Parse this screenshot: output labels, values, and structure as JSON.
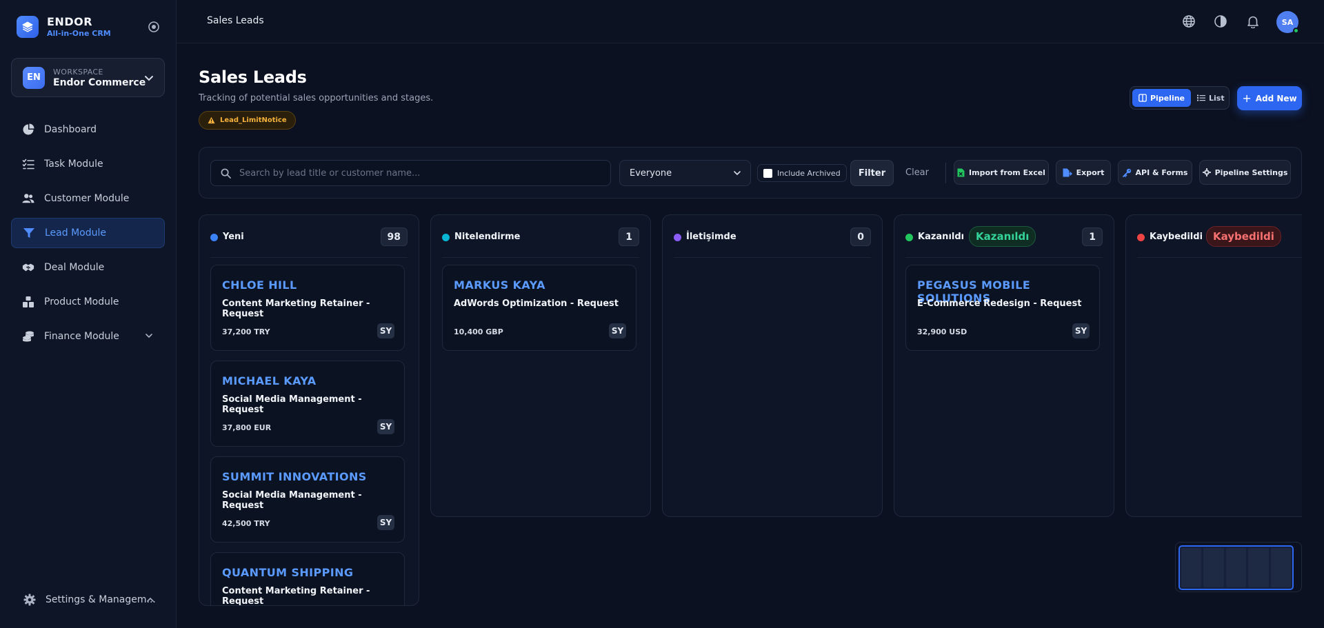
{
  "app": {
    "name": "ENDOR",
    "tagline": "All-in-One CRM"
  },
  "workspace": {
    "label": "WORKSPACE",
    "name": "Endor Commerce",
    "initials": "EN"
  },
  "sidebar": {
    "items": [
      {
        "label": "Dashboard",
        "icon": "pie-chart-icon"
      },
      {
        "label": "Task Module",
        "icon": "checklist-icon"
      },
      {
        "label": "Customer Module",
        "icon": "users-icon"
      },
      {
        "label": "Lead Module",
        "icon": "funnel-icon",
        "active": true
      },
      {
        "label": "Deal Module",
        "icon": "handshake-icon"
      },
      {
        "label": "Product Module",
        "icon": "boxes-icon"
      },
      {
        "label": "Finance Module",
        "icon": "coins-icon",
        "expandable": true
      }
    ],
    "settings_label": "Settings & Managem..."
  },
  "topbar": {
    "title": "Sales Leads",
    "user_initials": "SA"
  },
  "page": {
    "title": "Sales Leads",
    "subtitle": "Tracking of potential sales opportunities and stages.",
    "notice": "Lead_LimitNotice",
    "view_pipeline": "Pipeline",
    "view_list": "List",
    "add_new": "Add New"
  },
  "filters": {
    "search_placeholder": "Search by lead title or customer name...",
    "owner": "Everyone",
    "include_archived": "Include Archived",
    "filter_label": "Filter",
    "clear_label": "Clear",
    "import_label": "Import from Excel",
    "export_label": "Export",
    "api_label": "API & Forms",
    "pipeline_settings_label": "Pipeline Settings"
  },
  "columns": [
    {
      "title": "Yeni",
      "count": "98",
      "color": "#3b82f6",
      "cards": [
        {
          "company": "CHLOE HILL",
          "title": "Content Marketing Retainer - Request",
          "amount": "37,200 TRY",
          "owner": "SY"
        },
        {
          "company": "MICHAEL KAYA",
          "title": "Social Media Management - Request",
          "amount": "37,800 EUR",
          "owner": "SY"
        },
        {
          "company": "SUMMIT INNOVATIONS",
          "title": "Social Media Management - Request",
          "amount": "42,500 TRY",
          "owner": "SY"
        },
        {
          "company": "QUANTUM SHIPPING",
          "title": "Content Marketing Retainer - Request"
        }
      ]
    },
    {
      "title": "Nitelendirme",
      "count": "1",
      "color": "#06b6d4",
      "cards": [
        {
          "company": "MARKUS KAYA",
          "title": "AdWords Optimization - Request",
          "amount": "10,400 GBP",
          "owner": "SY"
        }
      ]
    },
    {
      "title": "İletişimde",
      "count": "0",
      "color": "#8b5cf6",
      "cards": []
    },
    {
      "title": "Kazanıldı",
      "tag": "Kazanıldı",
      "count": "1",
      "color": "#22c55e",
      "cards": [
        {
          "company": "PEGASUS MOBILE SOLUTIONS",
          "title": "E-Commerce Redesign - Request",
          "amount": "32,900 USD",
          "owner": "SY"
        }
      ]
    },
    {
      "title": "Kaybedildi",
      "tag": "Kaybedildi",
      "color": "#ef4444",
      "cards": []
    }
  ]
}
